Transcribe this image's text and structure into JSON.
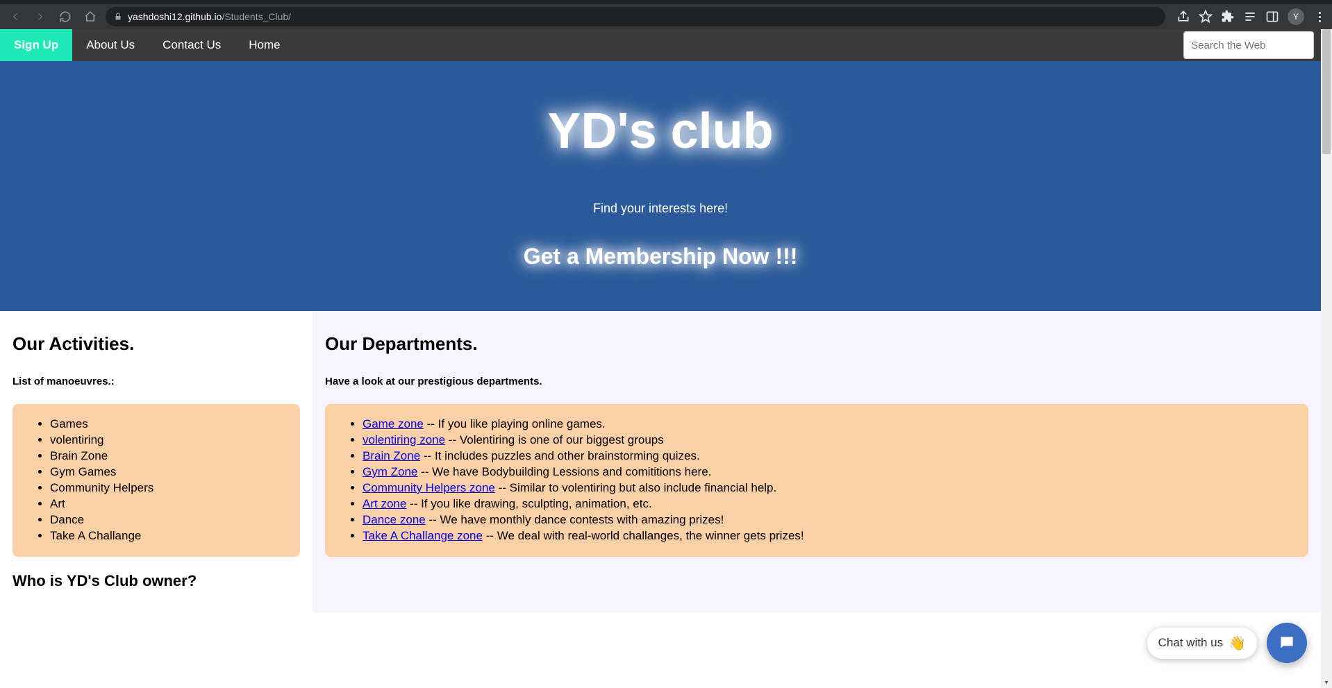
{
  "browser": {
    "url_host": "yashdoshi12.github.io",
    "url_path": "/Students_Club/",
    "avatar_letter": "Y"
  },
  "nav": {
    "signup": "Sign Up",
    "about": "About Us",
    "contact": "Contact Us",
    "home": "Home",
    "search_placeholder": "Search the Web"
  },
  "hero": {
    "title": "YD's club",
    "tagline": "Find your interests here!",
    "cta": "Get a Membership Now !!!"
  },
  "activities": {
    "heading": "Our Activities.",
    "sub": "List of manoeuvres.:",
    "items": [
      "Games",
      "volentiring",
      "Brain Zone",
      "Gym Games",
      "Community Helpers",
      "Art",
      "Dance",
      "Take A Challange"
    ],
    "owner_heading": "Who is YD's Club owner?"
  },
  "departments": {
    "heading": "Our Departments.",
    "sub": "Have a look at our prestigious departments.",
    "items": [
      {
        "link": "Game zone",
        "desc": " -- If you like playing online games."
      },
      {
        "link": "volentiring zone",
        "desc": " -- Volentiring is one of our biggest groups"
      },
      {
        "link": "Brain Zone",
        "desc": " -- It includes puzzles and other brainstorming quizes."
      },
      {
        "link": "Gym Zone",
        "desc": " -- We have Bodybuilding Lessions and comititions here."
      },
      {
        "link": "Community Helpers zone",
        "desc": " -- Similar to volentiring but also include financial help."
      },
      {
        "link": "Art zone",
        "desc": " -- If you like drawing, sculpting, animation, etc."
      },
      {
        "link": "Dance zone",
        "desc": " -- We have monthly dance contests with amazing prizes!"
      },
      {
        "link": "Take A Challange zone",
        "desc": " -- We deal with real-world challanges, the winner gets prizes!"
      }
    ]
  },
  "chat": {
    "label": "Chat with us",
    "emoji": "👋"
  }
}
